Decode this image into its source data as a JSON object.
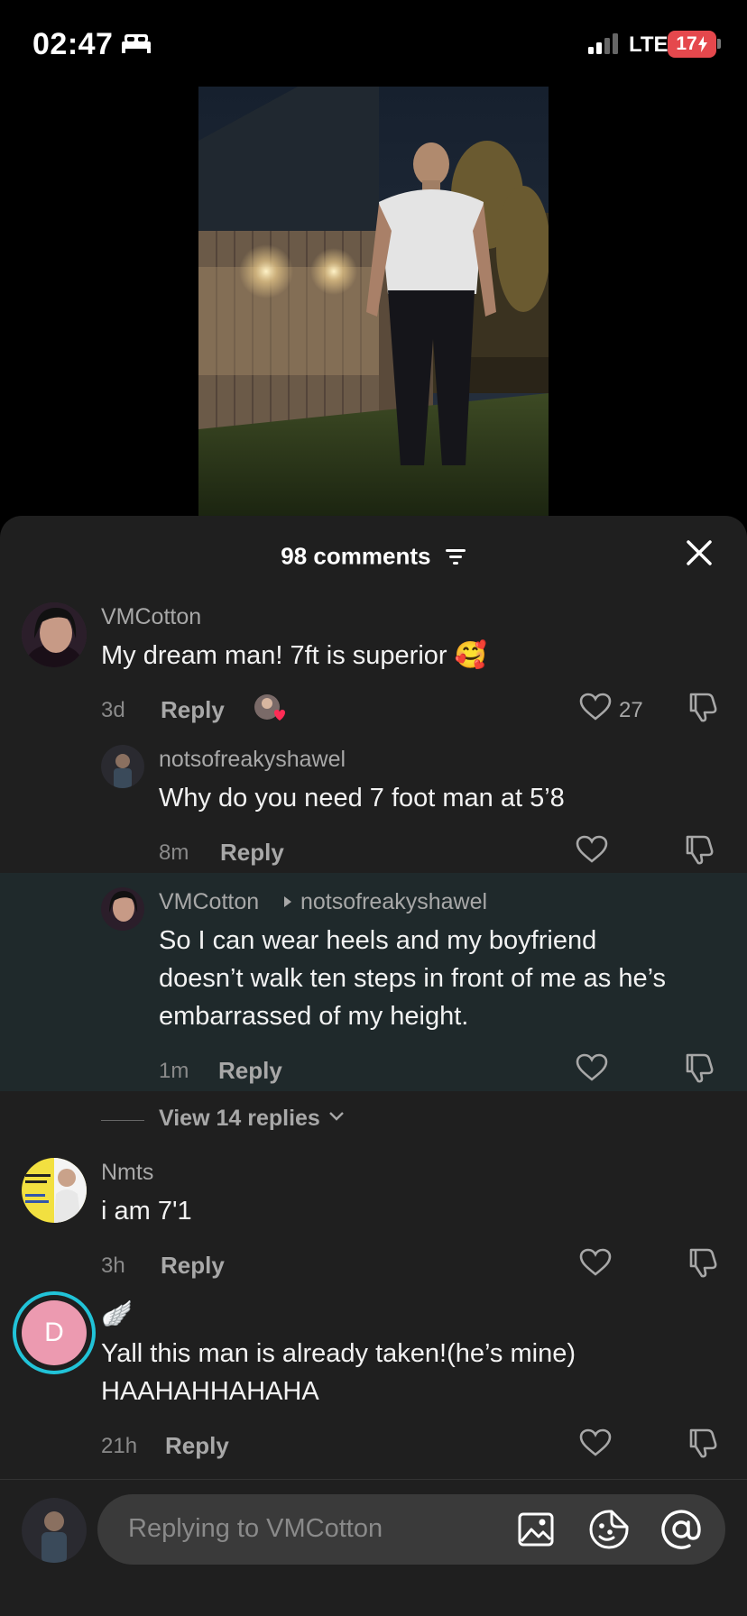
{
  "status_bar": {
    "time": "02:47",
    "network": "LTE",
    "battery": "17"
  },
  "video": {
    "description_icon": "video-frame"
  },
  "comments_panel": {
    "count_label": "98 comments",
    "comments": [
      {
        "username": "VMCotton",
        "text": "My dream man! 7ft is superior 🥰",
        "time": "3d",
        "reply_label": "Reply",
        "likes": "27"
      },
      {
        "username": "notsofreakyshawel",
        "text": "Why do you need 7 foot man at 5’8",
        "time": "8m",
        "reply_label": "Reply"
      },
      {
        "username": "VMCotton",
        "reply_to": "notsofreakyshawel",
        "text_lines": [
          "So I can wear heels and my boyfriend",
          "doesn’t walk ten steps in front of me as he’s",
          "embarrassed of my height."
        ],
        "time": "1m",
        "reply_label": "Reply"
      },
      {
        "username": "Nmts",
        "text": "i am 7'1",
        "time": "3h",
        "reply_label": "Reply"
      },
      {
        "username": "🪽",
        "avatar_letter": "D",
        "text_lines": [
          "Yall this man is already taken!(he’s mine)",
          "HAAHAHHAHAHA"
        ],
        "time": "21h",
        "reply_label": "Reply"
      }
    ],
    "view_replies_label": "View 14 replies"
  },
  "input": {
    "placeholder": "Replying to VMCotton"
  },
  "colors": {
    "panel_bg": "#1f1f1f",
    "highlight_bg": "#1f292b",
    "battery": "#e5484d",
    "story_ring": "#21c3d8"
  }
}
